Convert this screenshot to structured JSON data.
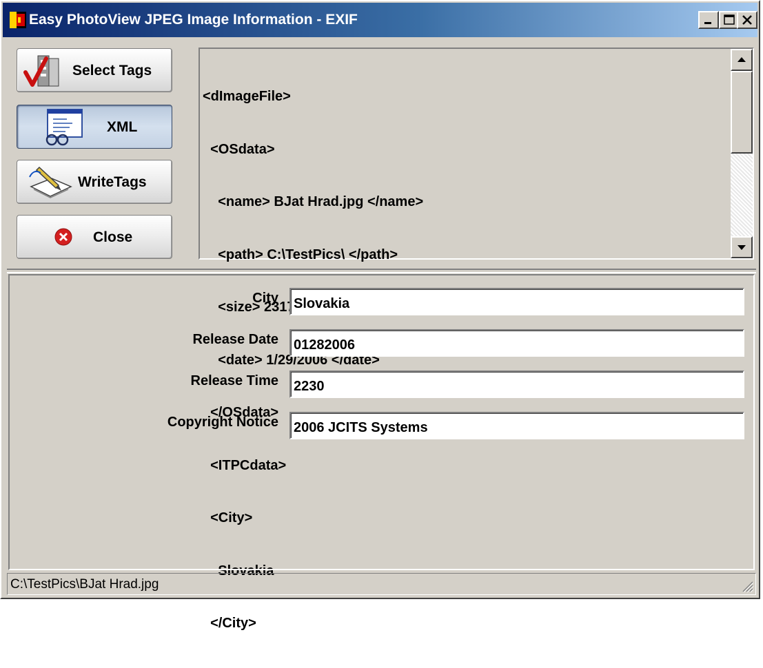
{
  "window": {
    "title": "Easy PhotoView JPEG Image Information - EXIF"
  },
  "toolbar": {
    "select_tags_label": "Select Tags",
    "xml_label": "XML",
    "write_tags_label": "WriteTags",
    "close_label": "Close"
  },
  "xml_view": {
    "lines": [
      "<dImageFile>",
      "  <OSdata>",
      "    <name> BJat Hrad.jpg </name>",
      "    <path> C:\\TestPics\\ </path>",
      "    <size> 231763 </size>",
      "    <date> 1/29/2006 </date>",
      "  </OSdata>",
      "  <ITPCdata>",
      "  <City>",
      "    Slovakia",
      "  </City>"
    ]
  },
  "fields": [
    {
      "label": "City",
      "value": "Slovakia"
    },
    {
      "label": "Release Date",
      "value": "01282006"
    },
    {
      "label": "Release Time",
      "value": "2230"
    },
    {
      "label": "Copyright Notice",
      "value": "2006 JCITS Systems"
    }
  ],
  "status": {
    "path": "C:\\TestPics\\BJat Hrad.jpg"
  },
  "icons": {
    "app": "app-icon",
    "select_tags": "checkmark-pages-icon",
    "xml": "xml-document-glasses-icon",
    "write_tags": "pen-paper-icon",
    "close": "red-x-circle-icon"
  },
  "colors": {
    "title_start": "#0a246a",
    "title_end": "#a6caf0",
    "face": "#d4d0c8",
    "close_red": "#d42020"
  }
}
